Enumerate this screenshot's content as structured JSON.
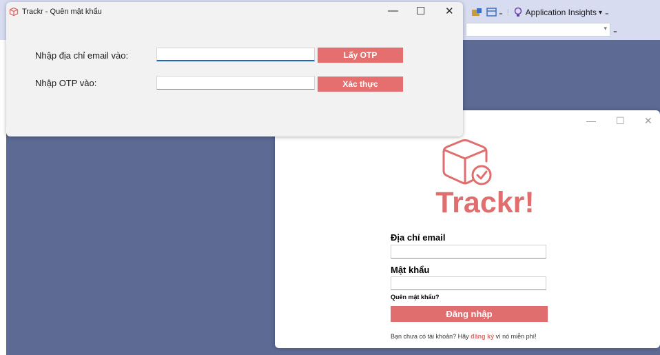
{
  "vs": {
    "app_insights_label": "Application Insights",
    "dropdown_arrow": "▾",
    "overflow_glyph": "₌"
  },
  "otp_window": {
    "title": "Trackr - Quên mật khẩu",
    "window_controls": {
      "minimize": "—",
      "maximize": "☐",
      "close": "✕"
    },
    "email_label": "Nhập địa chỉ email vào:",
    "email_value": "",
    "get_otp_label": "Lấy OTP",
    "otp_label": "Nhập OTP vào:",
    "otp_value": "",
    "verify_label": "Xác thực"
  },
  "login_window": {
    "window_controls": {
      "minimize": "—",
      "maximize": "☐",
      "close": "✕"
    },
    "brand": "Trackr!",
    "email_label": "Địa chỉ email",
    "email_value": "",
    "password_label": "Mật khẩu",
    "password_value": "",
    "forgot_link": "Quên mật khẩu?",
    "login_button": "Đăng nhập",
    "signup_prefix": "Bạn chưa có tài khoản? Hãy",
    "signup_link": "đăng ký",
    "signup_suffix": "vì nó miễn phí!"
  },
  "colors": {
    "accent": "#e06e6e",
    "workspace": "#5c6a94",
    "toolbar": "#d7dcf0"
  }
}
